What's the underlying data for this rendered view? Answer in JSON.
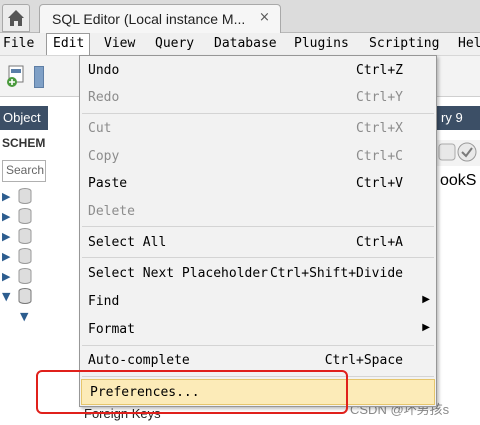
{
  "tab": {
    "title": "SQL Editor (Local instance M...",
    "close": "×"
  },
  "menubar": [
    "File",
    "Edit",
    "View",
    "Query",
    "Database",
    "Plugins",
    "Scripting",
    "Hel"
  ],
  "sidebar": {
    "header": "Object",
    "schemas": "SCHEM",
    "filter_placeholder": "Search"
  },
  "editor": {
    "tab_label": "ry 9",
    "text": "ookS"
  },
  "tree": {
    "foreign_keys": "Foreign Keys"
  },
  "edit_menu": [
    {
      "label": "Undo",
      "shortcut": "Ctrl+Z",
      "enabled": true
    },
    {
      "label": "Redo",
      "shortcut": "Ctrl+Y",
      "enabled": false
    },
    {
      "label": "Cut",
      "shortcut": "Ctrl+X",
      "enabled": false
    },
    {
      "label": "Copy",
      "shortcut": "Ctrl+C",
      "enabled": false
    },
    {
      "label": "Paste",
      "shortcut": "Ctrl+V",
      "enabled": true
    },
    {
      "label": "Delete",
      "shortcut": "",
      "enabled": false
    },
    {
      "label": "Select All",
      "shortcut": "Ctrl+A",
      "enabled": true
    },
    {
      "label": "Select Next Placeholder",
      "shortcut": "Ctrl+Shift+Divide",
      "enabled": true
    },
    {
      "label": "Find",
      "shortcut": "",
      "enabled": true,
      "submenu": true
    },
    {
      "label": "Format",
      "shortcut": "",
      "enabled": true,
      "submenu": true
    },
    {
      "label": "Auto-complete",
      "shortcut": "Ctrl+Space",
      "enabled": true
    },
    {
      "label": "Preferences...",
      "shortcut": "",
      "enabled": true,
      "hovered": true
    }
  ],
  "watermark": "CSDN @坏男孩s",
  "colors": {
    "hover": "#fcebb8",
    "annotation": "#e0201b",
    "sidebar_header": "#3c4f66"
  }
}
